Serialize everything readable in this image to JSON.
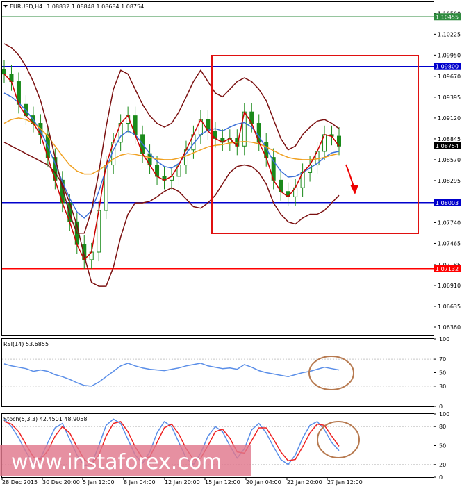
{
  "header": {
    "symbol": "EURUSD,H4",
    "ohlc": "1.08832 1.08848 1.08684 1.08754",
    "rsi_label": "RSI(14) 53.6855",
    "stoch_label": "Stoch(5,3,3) 42.4501 48.9058"
  },
  "watermark": "www.instaforex.com",
  "colors": {
    "green_level": "#2e8b3e",
    "blue_level": "#0000cc",
    "red_level": "#ff0000",
    "bollinger": "#7b1010",
    "price": "#cc0000",
    "candle": "#1a8a1a",
    "ma_fast": "#3a6fd8",
    "ma_slow": "#f0a020",
    "rsi": "#5a8ee8",
    "stoch_main": "#5a8ee8",
    "stoch_signal": "#ee2222",
    "circle": "#b77a50"
  },
  "chart_data": [
    {
      "type": "line",
      "title": "EURUSD,H4",
      "x_labels": [
        "28 Dec 2015",
        "30 Dec 20:00",
        "5 Jan 12:00",
        "8 Jan 04:00",
        "12 Jan 20:00",
        "15 Jan 12:00",
        "20 Jan 04:00",
        "22 Jan 20:00",
        "27 Jan 12:00"
      ],
      "y_ticks": [
        "1.10500",
        "1.10225",
        "1.09950",
        "1.09670",
        "1.09395",
        "1.09120",
        "1.08845",
        "1.08570",
        "1.08295",
        "1.07740",
        "1.07465",
        "1.07185",
        "1.06910",
        "1.06635",
        "1.06360"
      ],
      "ylim": [
        1.0625,
        1.1065
      ],
      "levels": [
        {
          "value": "1.10455",
          "color": "green"
        },
        {
          "value": "1.09800",
          "color": "blue"
        },
        {
          "value": "1.08754",
          "color": "black"
        },
        {
          "value": "1.08003",
          "color": "blue"
        },
        {
          "value": "1.07132",
          "color": "red"
        }
      ],
      "close": [
        1.097,
        1.096,
        1.093,
        1.0915,
        1.0905,
        1.089,
        1.086,
        1.083,
        1.08,
        1.0775,
        1.0745,
        1.0725,
        1.0735,
        1.079,
        1.085,
        1.088,
        1.0905,
        1.0915,
        1.089,
        1.0865,
        1.085,
        1.0835,
        1.083,
        1.0835,
        1.085,
        1.087,
        1.089,
        1.091,
        1.0895,
        1.0885,
        1.088,
        1.0885,
        1.0875,
        1.092,
        1.0905,
        1.088,
        1.086,
        1.083,
        1.0815,
        1.0808,
        1.082,
        1.084,
        1.085,
        1.0868,
        1.089,
        1.0888,
        1.0875
      ],
      "series": [
        {
          "name": "",
          "values": [
            1.0945,
            1.094,
            1.0932,
            1.0922,
            1.091,
            1.0895,
            1.0875,
            1.0852,
            1.0828,
            1.0806,
            1.0788,
            1.078,
            1.079,
            1.0815,
            1.0845,
            1.087,
            1.0888,
            1.0895,
            1.089,
            1.0878,
            1.0865,
            1.0855,
            1.0848,
            1.0846,
            1.0852,
            1.0865,
            1.0878,
            1.089,
            1.0896,
            1.0898,
            1.0895,
            1.09,
            1.0904,
            1.0906,
            1.09,
            1.0888,
            1.0872,
            1.0855,
            1.0842,
            1.0834,
            1.0835,
            1.084,
            1.0846,
            1.0852,
            1.086,
            1.0866,
            1.0868
          ]
        },
        {
          "name": "",
          "values": [
            1.0905,
            1.091,
            1.0912,
            1.091,
            1.0905,
            1.0898,
            1.0888,
            1.0875,
            1.0862,
            1.085,
            1.0842,
            1.0838,
            1.0838,
            1.0843,
            1.085,
            1.0858,
            1.0863,
            1.0865,
            1.0864,
            1.0862,
            1.086,
            1.0858,
            1.0857,
            1.0857,
            1.0859,
            1.0862,
            1.0866,
            1.087,
            1.0874,
            1.0876,
            1.0877,
            1.0879,
            1.088,
            1.0881,
            1.088,
            1.0878,
            1.0874,
            1.0869,
            1.0864,
            1.086,
            1.0858,
            1.0857,
            1.0857,
            1.0858,
            1.086,
            1.0863,
            1.0865
          ]
        },
        {
          "name": "",
          "values": [
            1.101,
            1.1005,
            1.0995,
            1.098,
            1.096,
            1.0935,
            1.09,
            1.086,
            1.082,
            1.0785,
            1.076,
            1.076,
            1.079,
            1.084,
            1.09,
            1.095,
            1.0975,
            1.097,
            1.095,
            1.093,
            1.0915,
            1.0905,
            1.09,
            1.0905,
            1.092,
            1.094,
            1.096,
            1.0975,
            1.096,
            1.0945,
            1.094,
            1.095,
            1.096,
            1.0965,
            1.096,
            1.095,
            1.0935,
            1.091,
            1.0885,
            1.087,
            1.0875,
            1.089,
            1.09,
            1.0908,
            1.091,
            1.0905,
            1.0898
          ]
        },
        {
          "name": "",
          "values": [
            1.088,
            1.0875,
            1.087,
            1.0865,
            1.086,
            1.0855,
            1.085,
            1.084,
            1.0825,
            1.08,
            1.077,
            1.073,
            1.0695,
            1.069,
            1.069,
            1.0715,
            1.0755,
            1.0785,
            1.08,
            1.08,
            1.0802,
            1.0808,
            1.0815,
            1.082,
            1.0815,
            1.0805,
            1.0795,
            1.0793,
            1.08,
            1.081,
            1.0825,
            1.084,
            1.0848,
            1.085,
            1.0848,
            1.084,
            1.0825,
            1.08,
            1.0785,
            1.0775,
            1.0772,
            1.078,
            1.0785,
            1.0785,
            1.079,
            1.08,
            1.081
          ]
        }
      ]
    },
    {
      "type": "line",
      "title": "RSI(14) 53.6855",
      "y_ticks": [
        "100",
        "70",
        "50",
        "30",
        "0"
      ],
      "ylim": [
        0,
        100
      ],
      "series": [
        {
          "name": "",
          "values": [
            63,
            60,
            58,
            56,
            52,
            54,
            52,
            47,
            44,
            40,
            35,
            31,
            30,
            36,
            44,
            52,
            60,
            64,
            60,
            57,
            55,
            54,
            53,
            55,
            57,
            60,
            62,
            64,
            60,
            58,
            56,
            57,
            55,
            62,
            58,
            53,
            50,
            48,
            46,
            44,
            47,
            50,
            52,
            55,
            58,
            56,
            54
          ]
        }
      ]
    },
    {
      "type": "line",
      "title": "Stoch(5,3,3) 42.4501 48.9058",
      "y_ticks": [
        "100",
        "80",
        "50",
        "20",
        "0"
      ],
      "ylim": [
        0,
        100
      ],
      "series": [
        {
          "name": "",
          "values": [
            92,
            80,
            62,
            40,
            22,
            30,
            55,
            78,
            85,
            60,
            35,
            18,
            20,
            50,
            82,
            92,
            85,
            60,
            35,
            22,
            40,
            70,
            88,
            80,
            55,
            30,
            20,
            38,
            65,
            80,
            72,
            50,
            30,
            45,
            75,
            85,
            70,
            48,
            28,
            20,
            35,
            62,
            82,
            88,
            75,
            55,
            42
          ]
        },
        {
          "name": "",
          "values": [
            88,
            84,
            72,
            52,
            32,
            28,
            42,
            65,
            80,
            70,
            48,
            28,
            20,
            35,
            65,
            85,
            88,
            72,
            48,
            30,
            32,
            55,
            78,
            84,
            68,
            45,
            28,
            30,
            50,
            72,
            76,
            62,
            40,
            38,
            58,
            78,
            78,
            60,
            40,
            26,
            28,
            48,
            70,
            84,
            82,
            65,
            49
          ]
        }
      ]
    }
  ]
}
